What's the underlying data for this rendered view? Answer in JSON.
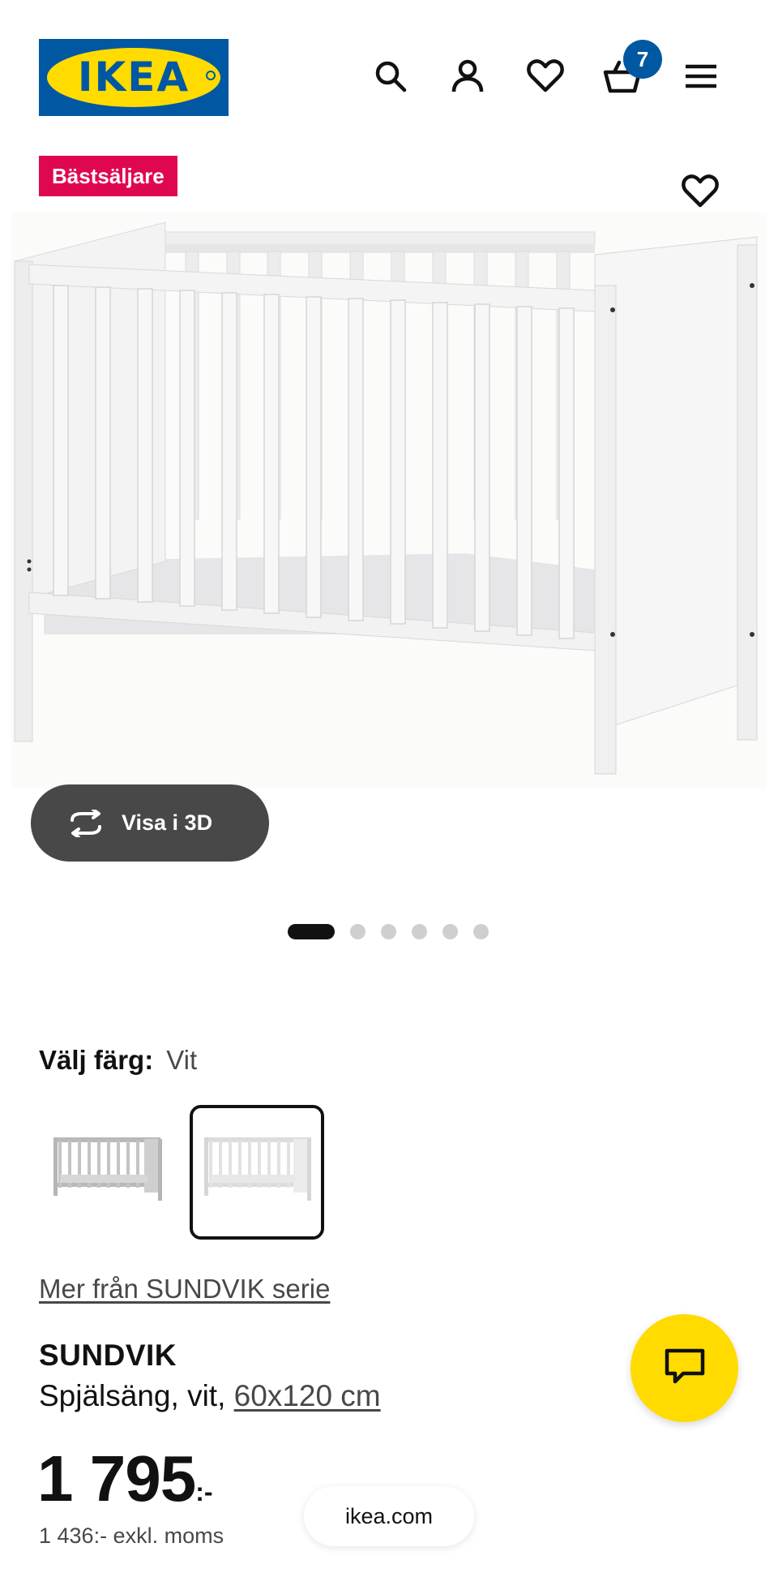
{
  "brand": {
    "logo_text": "IKEA",
    "colors": {
      "blue": "#0058a3",
      "yellow": "#ffdb00",
      "tag_red": "#e00751"
    }
  },
  "header": {
    "icons": [
      "search-icon",
      "user-icon",
      "heart-icon",
      "basket-icon",
      "menu-icon"
    ],
    "cart_count": "7"
  },
  "product_image": {
    "tag": "Bästsäljare",
    "view_3d_label": "Visa i 3D",
    "carousel": {
      "total": 6,
      "active_index": 0
    }
  },
  "color": {
    "label": "Välj färg:",
    "value": "Vit",
    "options": [
      "swatch-grey",
      "swatch-white"
    ],
    "selected_index": 1
  },
  "series_link": "Mer från SUNDVIK serie",
  "product": {
    "name": "SUNDVIK",
    "description_prefix": "Spjälsäng, vit,",
    "size_link": "60x120 cm",
    "price_main": "1 795",
    "price_suffix": ":-",
    "price_ex_vat": "1 436:- exkl. moms"
  },
  "browser": {
    "domain": "ikea.com"
  }
}
